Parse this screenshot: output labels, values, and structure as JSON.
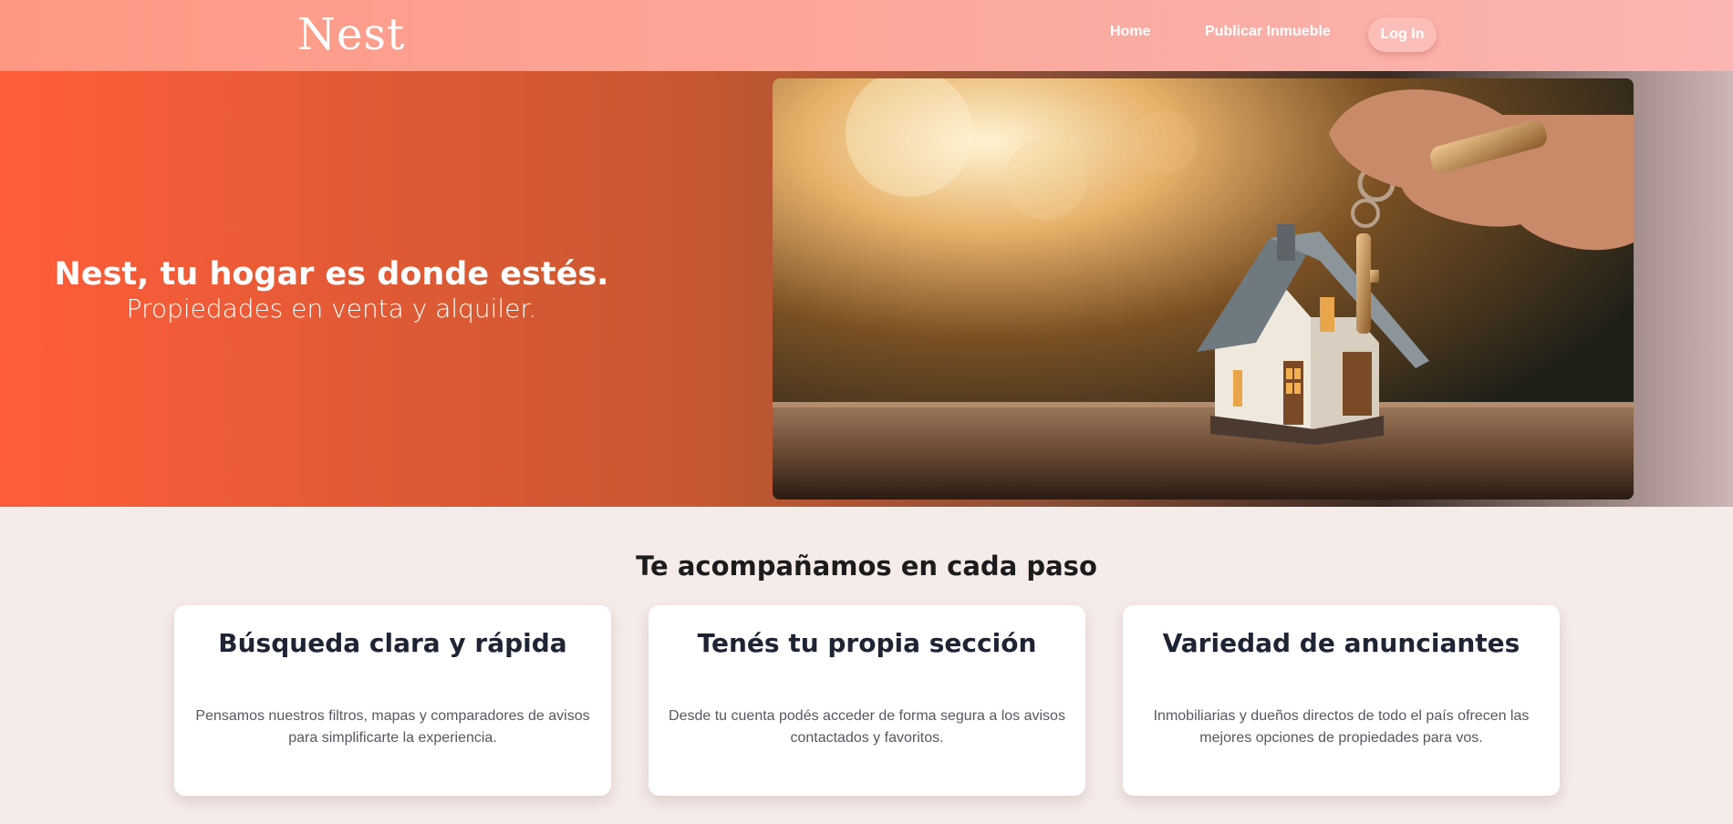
{
  "navbar": {
    "logo": "Nest",
    "links": [
      {
        "label": "Home"
      },
      {
        "label": "Publicar Inmueble"
      }
    ],
    "login_label": "Log In"
  },
  "hero": {
    "title": "Nest, tu hogar es donde estés.",
    "subtitle": "Propiedades en venta y alquiler.",
    "image": "house-with-keys-photo"
  },
  "features": {
    "title": "Te acompañamos en cada paso",
    "cards": [
      {
        "title": "Búsqueda clara y rápida",
        "text": "Pensamos nuestros filtros, mapas y comparadores de avisos para simplificarte la experiencia."
      },
      {
        "title": "Tenés tu propia sección",
        "text": "Desde tu cuenta podés acceder de forma segura a los avisos contactados y favoritos."
      },
      {
        "title": "Variedad de anunciantes",
        "text": "Inmobiliarias y dueños directos de todo el país ofrecen las mejores opciones de propiedades para vos."
      }
    ]
  },
  "colors": {
    "navbar_start": "#fe9883",
    "navbar_end": "#fbb5b2",
    "hero_start": "#ff5d3a",
    "background": "#f5ebe9",
    "card_title": "#1e2434"
  }
}
